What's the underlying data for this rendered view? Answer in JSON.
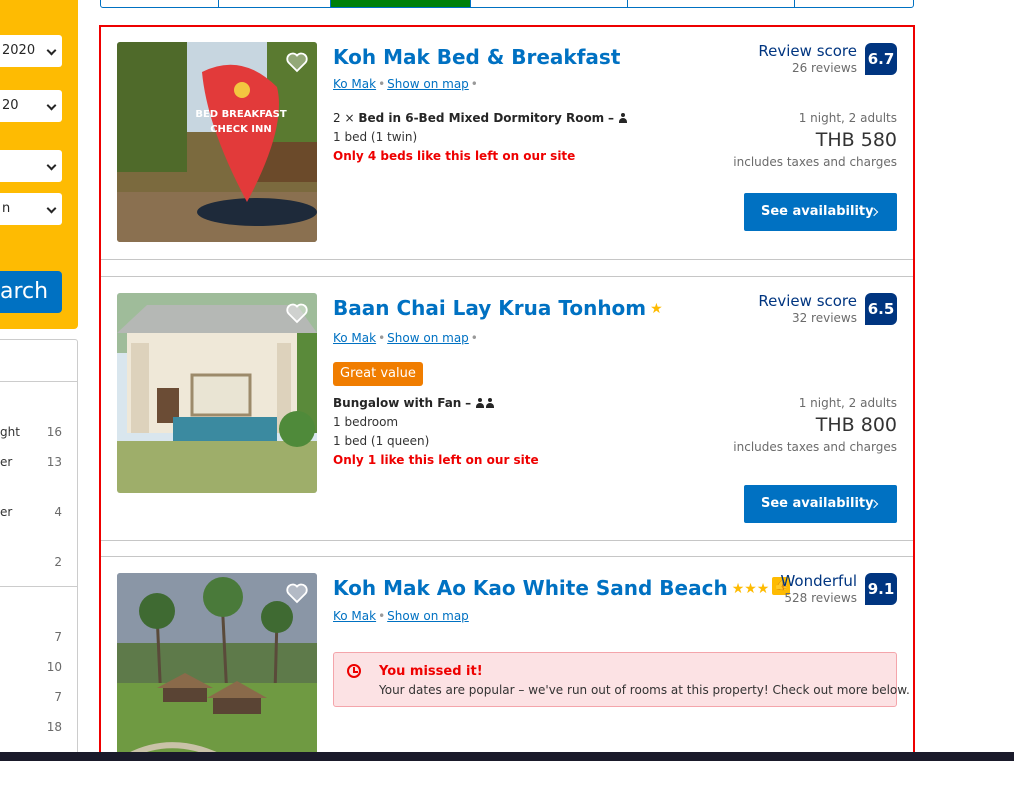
{
  "sidebar": {
    "fields": [
      {
        "value": "2020"
      },
      {
        "value": "20"
      },
      {
        "value": ""
      },
      {
        "value": "n"
      }
    ],
    "search_label": "arch",
    "filters": [
      {
        "label": "ght",
        "count": "16"
      },
      {
        "label": "er",
        "count": "13"
      },
      {
        "label": "er",
        "count": "4"
      },
      {
        "label": "",
        "count": "2"
      },
      {
        "label": "",
        "count": "7"
      },
      {
        "label": "",
        "count": "10"
      },
      {
        "label": "",
        "count": "7"
      },
      {
        "label": "",
        "count": "18"
      }
    ]
  },
  "sort_tabs": {
    "active_index": 2
  },
  "colors": {
    "brand_blue": "#0071c2",
    "dark_blue": "#003580",
    "yellow": "#febb02",
    "alert_red": "#e00",
    "value_orange": "#f07d00",
    "tab_green": "#008009"
  },
  "results": [
    {
      "name": "Koh Mak Bed & Breakfast",
      "stars": "",
      "location": "Ko Mak",
      "map_link": "Show on map",
      "review_label": "Review score",
      "review_count": "26 reviews",
      "score": "6.7",
      "room_qty": "2 ×",
      "room_type": "Bed in 6-Bed Mixed Dormitory Room",
      "room_dash": "–",
      "room_detail": "1 bed (1 twin)",
      "availability_warning": "Only 4 beds like this left on our site",
      "price_conditions": "1 night, 2 adults",
      "price": "THB 580",
      "price_note": "includes taxes and charges",
      "button_label": "See availability",
      "image": "koh-mak-bnb-sign-photo"
    },
    {
      "name": "Baan Chai Lay Krua Tonhom",
      "stars": "★",
      "location": "Ko Mak",
      "map_link": "Show on map",
      "review_label": "Review score",
      "review_count": "32 reviews",
      "score": "6.5",
      "badge": "Great value",
      "room_type": "Bungalow with Fan",
      "room_dash": "–",
      "room_detail_1": "1 bedroom",
      "room_detail_2": "1 bed (1 queen)",
      "availability_warning": "Only 1 like this left on our site",
      "price_conditions": "1 night, 2 adults",
      "price": "THB 800",
      "price_note": "includes taxes and charges",
      "button_label": "See availability",
      "image": "bungalow-photo"
    },
    {
      "name": "Koh Mak Ao Kao White Sand Beach",
      "stars": "★★★",
      "location": "Ko Mak",
      "map_link": "Show on map",
      "review_label": "Wonderful",
      "review_count": "528 reviews",
      "score": "9.1",
      "missed_title": "You missed it!",
      "missed_body": "Your dates are popular – we've run out of rooms at this property! Check out more below.",
      "image": "beach-resort-photo"
    }
  ]
}
